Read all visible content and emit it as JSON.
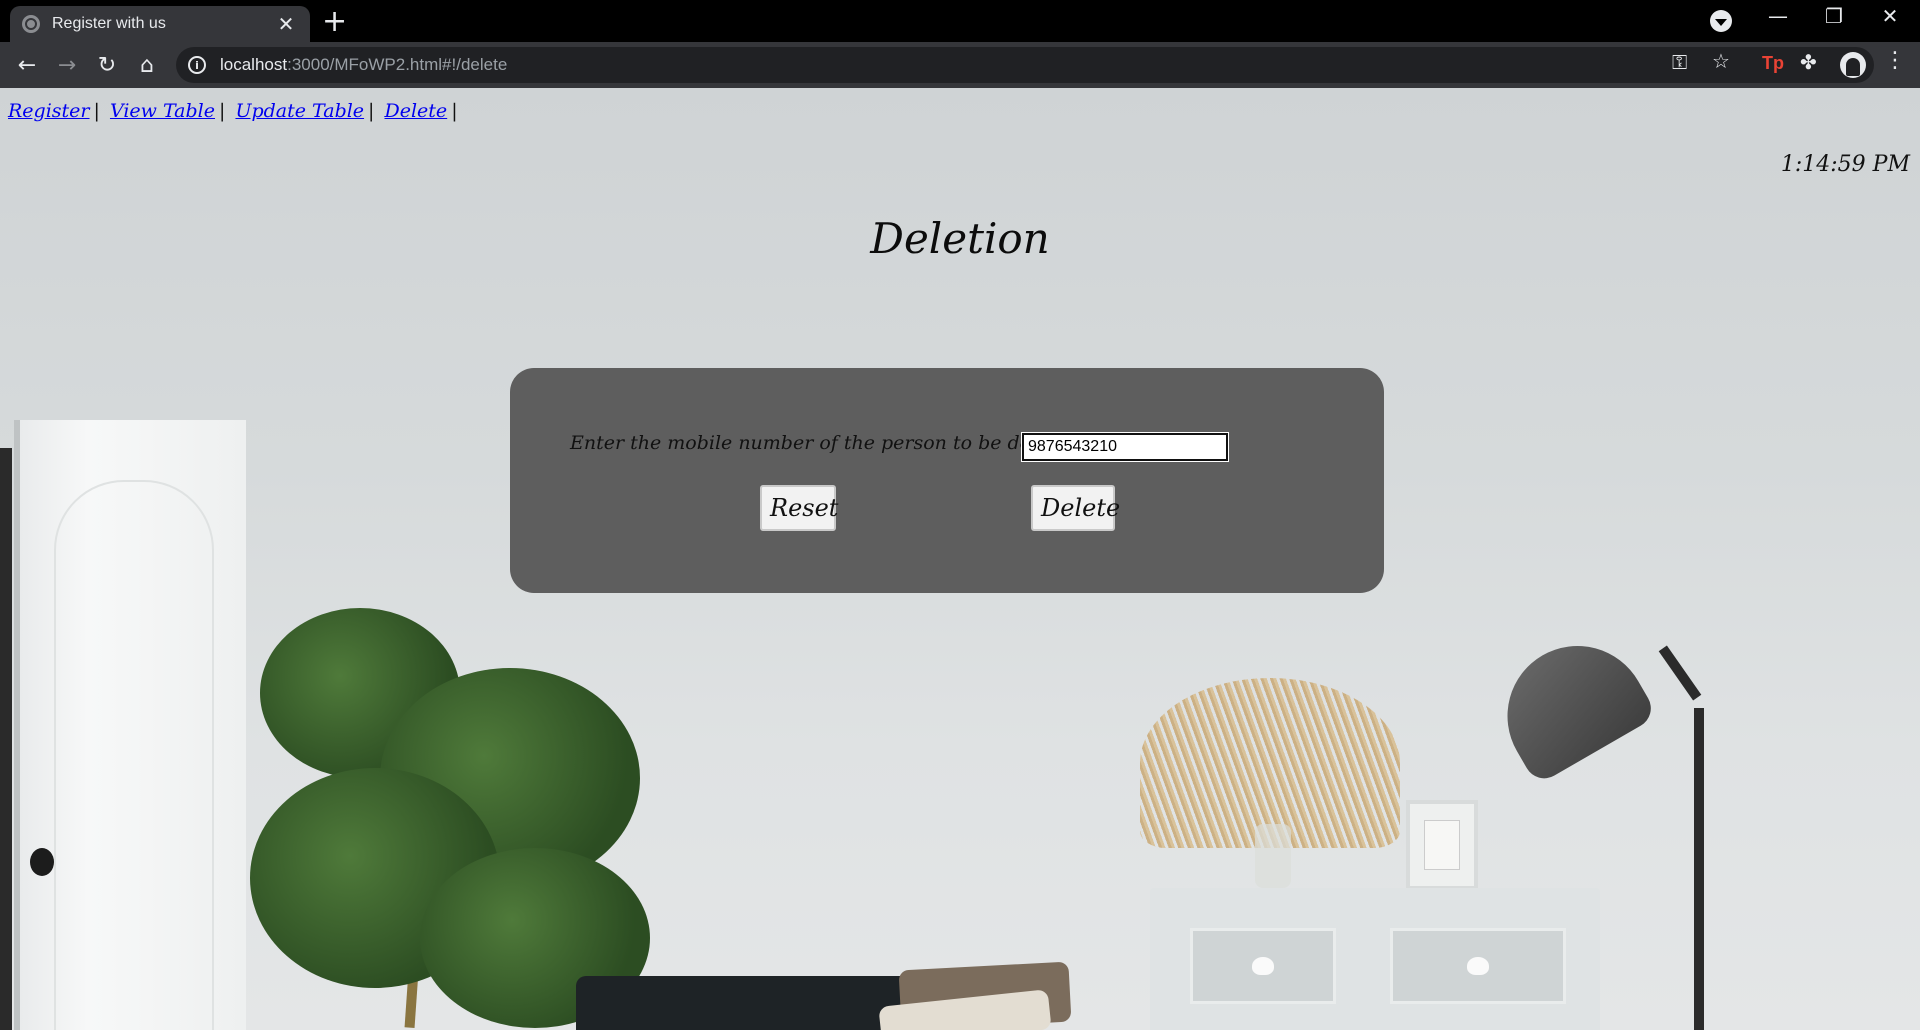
{
  "browser": {
    "tab_title": "Register with us",
    "tab_close": "✕",
    "new_tab": "+",
    "url_host": "localhost",
    "url_path": ":3000/MFoWP2.html#!/delete",
    "window": {
      "minimize": "—",
      "restore": "❐",
      "close": "✕"
    },
    "icons": {
      "back": "←",
      "forward": "→",
      "reload": "↻",
      "home": "⌂",
      "info": "i",
      "key": "⚿",
      "star": "☆",
      "extension_tp": "Tp",
      "puzzle": "✤",
      "menu": "⋮"
    }
  },
  "nav": {
    "links": [
      "Register",
      "View Table",
      "Update Table",
      "Delete"
    ],
    "separator": "|"
  },
  "clock": "1:14:59 PM",
  "heading": "Deletion",
  "form": {
    "prompt": "Enter the mobile number of the person to be deleted :",
    "mobile_value": "9876543210",
    "reset_label": "Reset",
    "delete_label": "Delete"
  }
}
